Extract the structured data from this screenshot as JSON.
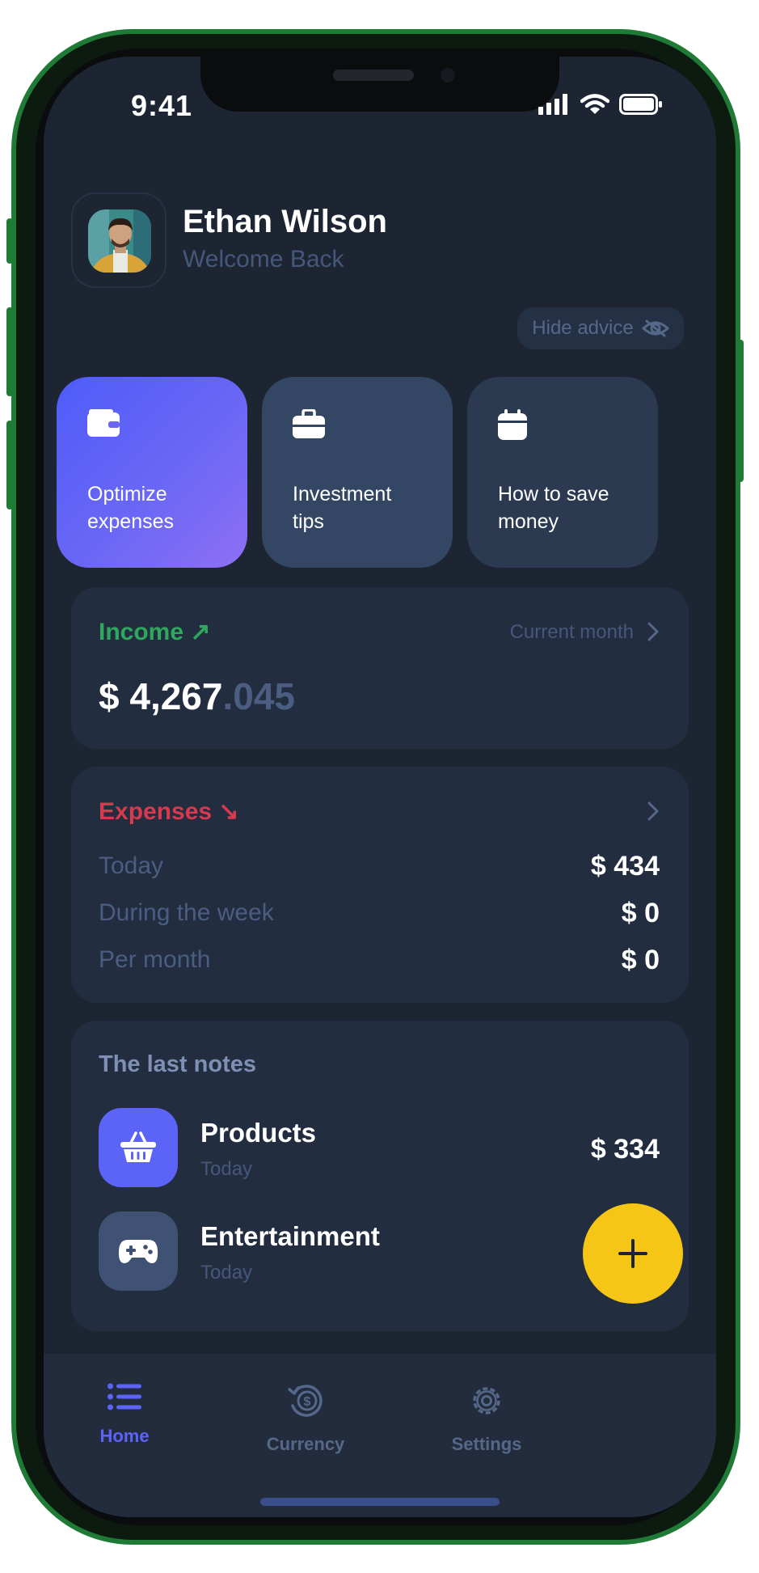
{
  "status_bar": {
    "time": "9:41"
  },
  "profile": {
    "name": "Ethan Wilson",
    "subtitle": "Welcome Back"
  },
  "hide_advice": {
    "label": "Hide advice"
  },
  "advice_cards": [
    {
      "label": "Optimize\nexpenses",
      "icon": "wallet-icon"
    },
    {
      "label": "Investment\ntips",
      "icon": "briefcase-icon"
    },
    {
      "label": "How to save\nmoney",
      "icon": "calendar-icon"
    }
  ],
  "income": {
    "title": "Income ↗",
    "period": "Current month",
    "amount_main": "$ 4,267",
    "amount_decimal": ".045"
  },
  "expenses": {
    "title": "Expenses ↘",
    "rows": [
      {
        "label": "Today",
        "value": "$ 434"
      },
      {
        "label": "During the week",
        "value": "$ 0"
      },
      {
        "label": "Per month",
        "value": "$ 0"
      }
    ]
  },
  "notes": {
    "title": "The last notes",
    "items": [
      {
        "name": "Products",
        "date": "Today",
        "value": "$ 334",
        "icon": "basket-icon"
      },
      {
        "name": "Entertainment",
        "date": "Today",
        "value": "",
        "icon": "gamepad-icon"
      }
    ]
  },
  "tabs": [
    {
      "label": "Home",
      "icon": "list-icon",
      "active": true
    },
    {
      "label": "Currency",
      "icon": "currency-icon",
      "active": false
    },
    {
      "label": "Settings",
      "icon": "gear-icon",
      "active": false
    }
  ],
  "colors": {
    "accent": "#5b64f7",
    "income": "#2fa85e",
    "expenses": "#d7394e",
    "fab": "#f6c616"
  }
}
